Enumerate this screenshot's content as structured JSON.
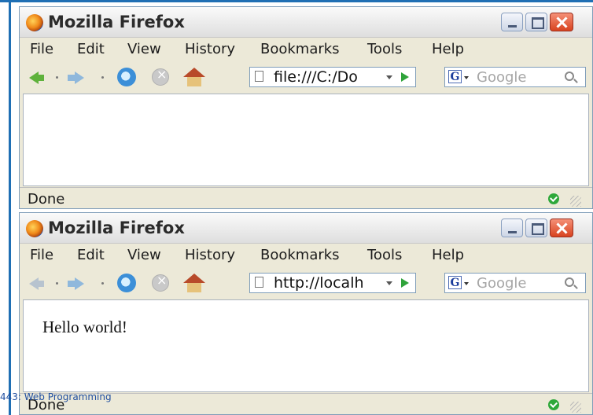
{
  "windows": [
    {
      "title": "Mozilla Firefox",
      "menu": [
        "File",
        "Edit",
        "View",
        "History",
        "Bookmarks",
        "Tools",
        "Help"
      ],
      "url": "file:///C:/Do",
      "search_placeholder": "Google",
      "content_text": "",
      "status": "Done"
    },
    {
      "title": "Mozilla Firefox",
      "menu": [
        "File",
        "Edit",
        "View",
        "History",
        "Bookmarks",
        "Tools",
        "Help"
      ],
      "url": "http://localh",
      "search_placeholder": "Google",
      "content_text": "Hello world!",
      "status": "Done"
    }
  ],
  "footer": {
    "text": "443: Web Programming"
  },
  "colors": {
    "accent_line": "#1f6fb4",
    "chrome": "#ece9d8",
    "close_button": "#d8431f"
  },
  "icons": [
    "firefox-icon",
    "back-arrow-icon",
    "forward-arrow-icon",
    "reload-icon",
    "stop-icon",
    "home-icon",
    "page-icon",
    "go-icon",
    "google-icon",
    "search-icon",
    "status-ok-icon",
    "resize-grip-icon"
  ]
}
